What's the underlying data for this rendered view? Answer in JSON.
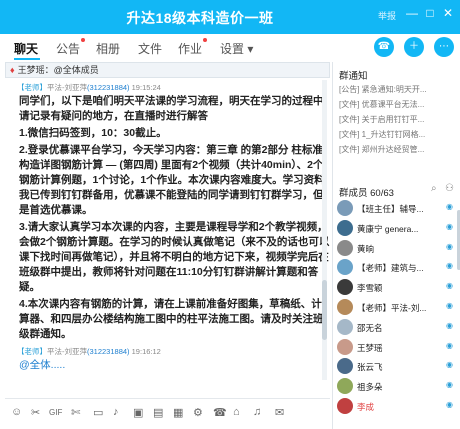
{
  "window": {
    "title": "升达18级本科造价一班",
    "hint": "举报",
    "min": "—",
    "max": "□",
    "close": "✕"
  },
  "tabs": [
    {
      "label": "聊天",
      "active": true
    },
    {
      "label": "公告"
    },
    {
      "label": "相册"
    },
    {
      "label": "文件"
    },
    {
      "label": "作业"
    },
    {
      "label": "设置 ▾"
    }
  ],
  "sender": {
    "name": "王梦瑶：",
    "text": "@全体成员"
  },
  "messages": [
    {
      "tag": "【老师】",
      "name": "平法-刘亚萍",
      "qq": "(312231884)",
      "time": "19:15:24",
      "paragraphs": [
        "同学们，以下是咱们明天平法课的学习流程，明天在学习的过程中请记录有疑问的地方，在直播时进行解答",
        "1.微信扫码签到，10：30截止。",
        "2.登录优慕课平台学习，今天学习内容：第三章 的第2部分 柱标准构造详图钢筋计算 — (第四周) 里面有2个视频（共计40min）、2个钢筋计算例题，1个讨论，1个作业。本次课内容难度大。学习资料我已传到钉钉群备用，优慕课不能登陆的同学请到钉钉群学习，但是首选优慕课。",
        "3.请大家认真学习本次课的内容，主要是课程导学和2个教学视频，会做2个钢筋计算题。在学习的时候认真做笔记（来不及的话也可以课下找时间再做笔记），并且将不明白的地方记下来，视频学完后在班级群中提出，教师将针对问题在11:10分钉钉群讲解计算题和答疑。",
        "4.本次课内容有钢筋的计算，请在上课前准备好图集，草稿纸、计算器、和四层办公楼结构施工图中的柱平法施工图。请及时关注班级群通知。"
      ]
    },
    {
      "tag": "【老师】",
      "name": "平法-刘亚萍",
      "qq": "(312231884)",
      "time": "19:16:12",
      "paragraphs": [
        "@全体....."
      ]
    }
  ],
  "notices": {
    "title": "群通知",
    "items": [
      "[公告] 紧急通知:明天开...",
      "[文件] 优慕课平台无法...",
      "[文件] 关于启用钉钉平...",
      "[文件] 1_升达钉钉网格...",
      "[文件] 郑州升达经贸管..."
    ]
  },
  "members": {
    "title": "群成员 60/63",
    "list": [
      {
        "name": "【班主任】辅导...",
        "color": "#7a9bb8"
      },
      {
        "name": "黄康宁 genera...",
        "color": "#3d6d8f"
      },
      {
        "name": "黄晌",
        "color": "#8a8a8a"
      },
      {
        "name": "【老师】建筑与...",
        "color": "#6aa3c9"
      },
      {
        "name": "李雪颖",
        "color": "#3a3a3a"
      },
      {
        "name": "【老师】平法-刘...",
        "color": "#b58a5a"
      },
      {
        "name": "邵无名",
        "color": "#a5b8c8"
      },
      {
        "name": "王梦瑶",
        "color": "#c89a8a"
      },
      {
        "name": "张云飞",
        "color": "#4a6a8a"
      },
      {
        "name": "祖多朵",
        "color": "#8fa85a"
      },
      {
        "name": "李成",
        "color": "#c04040",
        "red": true
      }
    ]
  },
  "toolbar": [
    "☺",
    "✂",
    "GIF",
    "✄",
    "▭",
    "♪",
    "▣",
    "▤",
    "▦",
    "⚙",
    "☎",
    "⌂",
    "♫",
    "✉"
  ]
}
